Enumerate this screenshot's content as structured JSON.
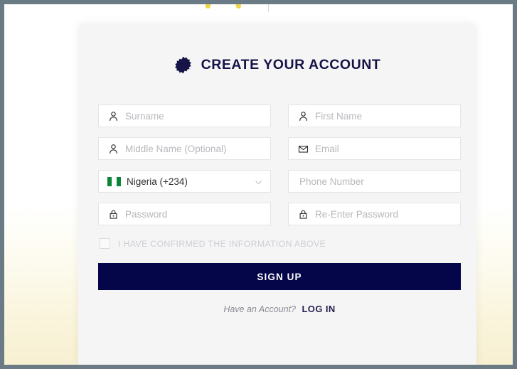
{
  "window": {
    "frame_color": "#6b7b85",
    "background_gradient_top": "#ffffff",
    "background_gradient_bottom": "#f7f0d2"
  },
  "top_bar": {
    "logo_icon": "partial-yellow-logo-icon",
    "divider_icon": "vertical-divider-icon"
  },
  "card": {
    "background_color": "#f5f5f6",
    "heading": {
      "badge_icon": "navy-starburst-badge-icon",
      "badge_color": "#161347",
      "title": "CREATE YOUR ACCOUNT",
      "title_color": "#161347"
    },
    "form": {
      "rows": [
        {
          "left": {
            "name": "surname-field",
            "icon": "person-icon",
            "placeholder": "Surname",
            "value": ""
          },
          "right": {
            "name": "first-name-field",
            "icon": "person-icon",
            "placeholder": "First Name",
            "value": ""
          }
        },
        {
          "left": {
            "name": "middle-name-field",
            "icon": "person-icon",
            "placeholder": "Middle Name (Optional)",
            "value": ""
          },
          "right": {
            "name": "email-field",
            "icon": "envelope-icon",
            "placeholder": "Email",
            "value": ""
          }
        },
        {
          "left": {
            "name": "country-code-select",
            "icon": "nigeria-flag-icon",
            "selected": "Nigeria (+234)",
            "chevron_icon": "chevron-down-icon"
          },
          "right": {
            "name": "phone-number-field",
            "icon": "",
            "placeholder": "Phone Number",
            "value": ""
          }
        },
        {
          "left": {
            "name": "password-field",
            "icon": "lock-icon",
            "placeholder": "Password",
            "value": ""
          },
          "right": {
            "name": "confirm-password-field",
            "icon": "lock-icon",
            "placeholder": "Re-Enter Password",
            "value": ""
          }
        }
      ],
      "confirm": {
        "checked": false,
        "label": "I HAVE CONFIRMED THE INFORMATION ABOVE"
      },
      "submit_label": "SIGN UP",
      "submit_color": "#05054a"
    },
    "footer": {
      "text": "Have an Account?",
      "link": "LOG IN",
      "link_color": "#2a1f4e"
    }
  }
}
